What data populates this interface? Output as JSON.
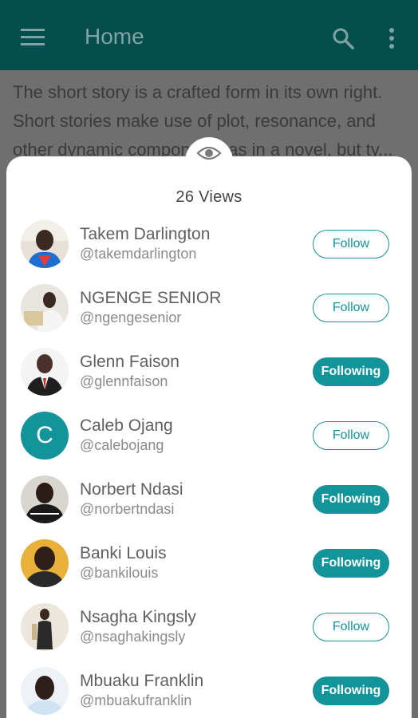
{
  "appbar": {
    "title": "Home",
    "menu_icon": "hamburger-menu-icon",
    "search_icon": "search-icon",
    "more_icon": "more-vert-icon"
  },
  "story": {
    "lines": [
      "The short story is a crafted form in its own right.",
      "Short stories make use of plot, resonance, and",
      "other dynamic components as in a novel, but ty..."
    ]
  },
  "sheet": {
    "eye_icon": "eye-icon",
    "views_label": "26 Views",
    "users": [
      {
        "name": "Takem Darlington",
        "handle": "@takemdarlington",
        "status": "Follow",
        "avatar": "photo"
      },
      {
        "name": "NGENGE SENIOR",
        "handle": "@ngengesenior",
        "status": "Follow",
        "avatar": "photo"
      },
      {
        "name": "Glenn Faison",
        "handle": "@glennfaison",
        "status": "Following",
        "avatar": "photo"
      },
      {
        "name": "Caleb Ojang",
        "handle": "@calebojang",
        "status": "Follow",
        "avatar": "C"
      },
      {
        "name": "Norbert Ndasi",
        "handle": "@norbertndasi",
        "status": "Following",
        "avatar": "photo"
      },
      {
        "name": "Banki Louis",
        "handle": "@bankilouis",
        "status": "Following",
        "avatar": "photo"
      },
      {
        "name": "Nsagha Kingsly",
        "handle": "@nsaghakingsly",
        "status": "Follow",
        "avatar": "photo"
      },
      {
        "name": "Mbuaku Franklin",
        "handle": "@mbuakufranklin",
        "status": "Following",
        "avatar": "photo"
      }
    ]
  },
  "colors": {
    "appbar": "#044e4e",
    "accent": "#13939a",
    "scrim_text": "#3a3a3a"
  }
}
